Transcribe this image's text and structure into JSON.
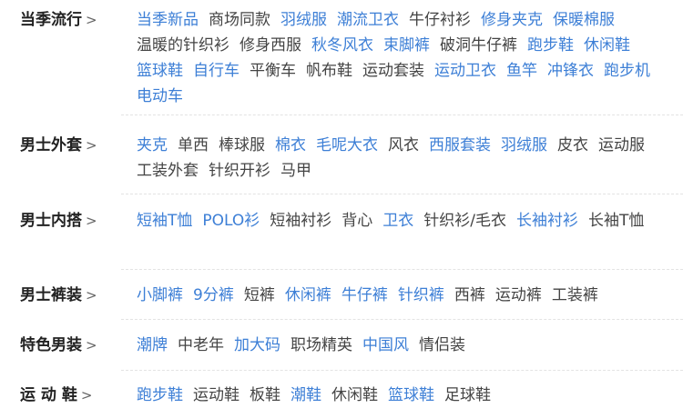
{
  "colors": {
    "highlight": "#3d7fd6",
    "normal": "#444444",
    "heading": "#222222",
    "divider": "#e3e3e3"
  },
  "arrow": ">",
  "categories": [
    {
      "title": "当季流行",
      "items": [
        {
          "label": "当季新品",
          "highlight": true
        },
        {
          "label": "商场同款",
          "highlight": false
        },
        {
          "label": "羽绒服",
          "highlight": true
        },
        {
          "label": "潮流卫衣",
          "highlight": true
        },
        {
          "label": "牛仔衬衫",
          "highlight": false
        },
        {
          "label": "修身夹克",
          "highlight": true
        },
        {
          "label": "保暖棉服",
          "highlight": true
        },
        {
          "label": "温暖的针织衫",
          "highlight": false
        },
        {
          "label": "修身西服",
          "highlight": false
        },
        {
          "label": "秋冬风衣",
          "highlight": true
        },
        {
          "label": "束脚裤",
          "highlight": true
        },
        {
          "label": "破洞牛仔裤",
          "highlight": false
        },
        {
          "label": "跑步鞋",
          "highlight": true
        },
        {
          "label": "休闲鞋",
          "highlight": true
        },
        {
          "label": "篮球鞋",
          "highlight": true
        },
        {
          "label": "自行车",
          "highlight": true
        },
        {
          "label": "平衡车",
          "highlight": false
        },
        {
          "label": "帆布鞋",
          "highlight": false
        },
        {
          "label": "运动套装",
          "highlight": false
        },
        {
          "label": "运动卫衣",
          "highlight": true
        },
        {
          "label": "鱼竿",
          "highlight": true
        },
        {
          "label": "冲锋衣",
          "highlight": true
        },
        {
          "label": "跑步机",
          "highlight": true
        },
        {
          "label": "电动车",
          "highlight": true
        }
      ]
    },
    {
      "title": "男士外套",
      "items": [
        {
          "label": "夹克",
          "highlight": true
        },
        {
          "label": "单西",
          "highlight": false
        },
        {
          "label": "棒球服",
          "highlight": false
        },
        {
          "label": "棉衣",
          "highlight": true
        },
        {
          "label": "毛呢大衣",
          "highlight": true
        },
        {
          "label": "风衣",
          "highlight": false
        },
        {
          "label": "西服套装",
          "highlight": true
        },
        {
          "label": "羽绒服",
          "highlight": true
        },
        {
          "label": "皮衣",
          "highlight": false
        },
        {
          "label": "运动服",
          "highlight": false
        },
        {
          "label": "工装外套",
          "highlight": false
        },
        {
          "label": "针织开衫",
          "highlight": false
        },
        {
          "label": "马甲",
          "highlight": false
        }
      ]
    },
    {
      "title": "男士内搭",
      "items": [
        {
          "label": "短袖T恤",
          "highlight": true
        },
        {
          "label": "POLO衫",
          "highlight": true
        },
        {
          "label": "短袖衬衫",
          "highlight": false
        },
        {
          "label": "背心",
          "highlight": false
        },
        {
          "label": "卫衣",
          "highlight": true
        },
        {
          "label": "针织衫/毛衣",
          "highlight": false
        },
        {
          "label": "长袖衬衫",
          "highlight": true
        },
        {
          "label": "长袖T恤",
          "highlight": false
        }
      ]
    },
    {
      "title": "男士裤装",
      "items": [
        {
          "label": "小脚裤",
          "highlight": true
        },
        {
          "label": "9分裤",
          "highlight": true
        },
        {
          "label": "短裤",
          "highlight": false
        },
        {
          "label": "休闲裤",
          "highlight": true
        },
        {
          "label": "牛仔裤",
          "highlight": true
        },
        {
          "label": "针织裤",
          "highlight": true
        },
        {
          "label": "西裤",
          "highlight": false
        },
        {
          "label": "运动裤",
          "highlight": false
        },
        {
          "label": "工装裤",
          "highlight": false
        }
      ]
    },
    {
      "title": "特色男装",
      "items": [
        {
          "label": "潮牌",
          "highlight": true
        },
        {
          "label": "中老年",
          "highlight": false
        },
        {
          "label": "加大码",
          "highlight": true
        },
        {
          "label": "职场精英",
          "highlight": false
        },
        {
          "label": "中国风",
          "highlight": true
        },
        {
          "label": "情侣装",
          "highlight": false
        }
      ]
    },
    {
      "title": "运 动 鞋",
      "items": [
        {
          "label": "跑步鞋",
          "highlight": true
        },
        {
          "label": "运动鞋",
          "highlight": false
        },
        {
          "label": "板鞋",
          "highlight": false
        },
        {
          "label": "潮鞋",
          "highlight": true
        },
        {
          "label": "休闲鞋",
          "highlight": false
        },
        {
          "label": "篮球鞋",
          "highlight": true
        },
        {
          "label": "足球鞋",
          "highlight": false
        }
      ]
    }
  ]
}
